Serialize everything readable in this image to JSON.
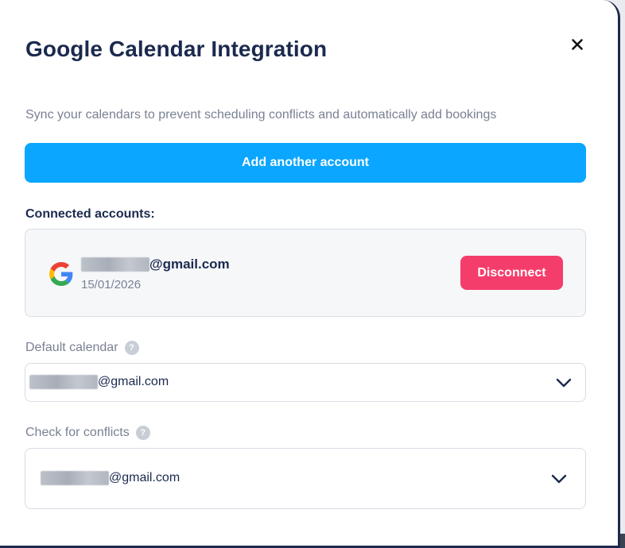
{
  "modal": {
    "title": "Google Calendar Integration",
    "subtitle": "Sync your calendars to prevent scheduling conflicts and automatically add bookings",
    "close_icon": "close-icon"
  },
  "add_account": {
    "label": "Add another account",
    "color": "#0aa6ff"
  },
  "connected": {
    "heading": "Connected accounts:",
    "accounts": [
      {
        "provider_icon": "google-logo-icon",
        "email_suffix": "@gmail.com",
        "date": "15/01/2026",
        "disconnect_label": "Disconnect",
        "disconnect_color": "#f53d6b"
      }
    ]
  },
  "default_calendar": {
    "label": "Default calendar",
    "help_icon": "question-icon",
    "selected_suffix": "@gmail.com"
  },
  "check_conflicts": {
    "label": "Check for conflicts",
    "help_icon": "question-icon",
    "selected_suffix": "@gmail.com"
  }
}
